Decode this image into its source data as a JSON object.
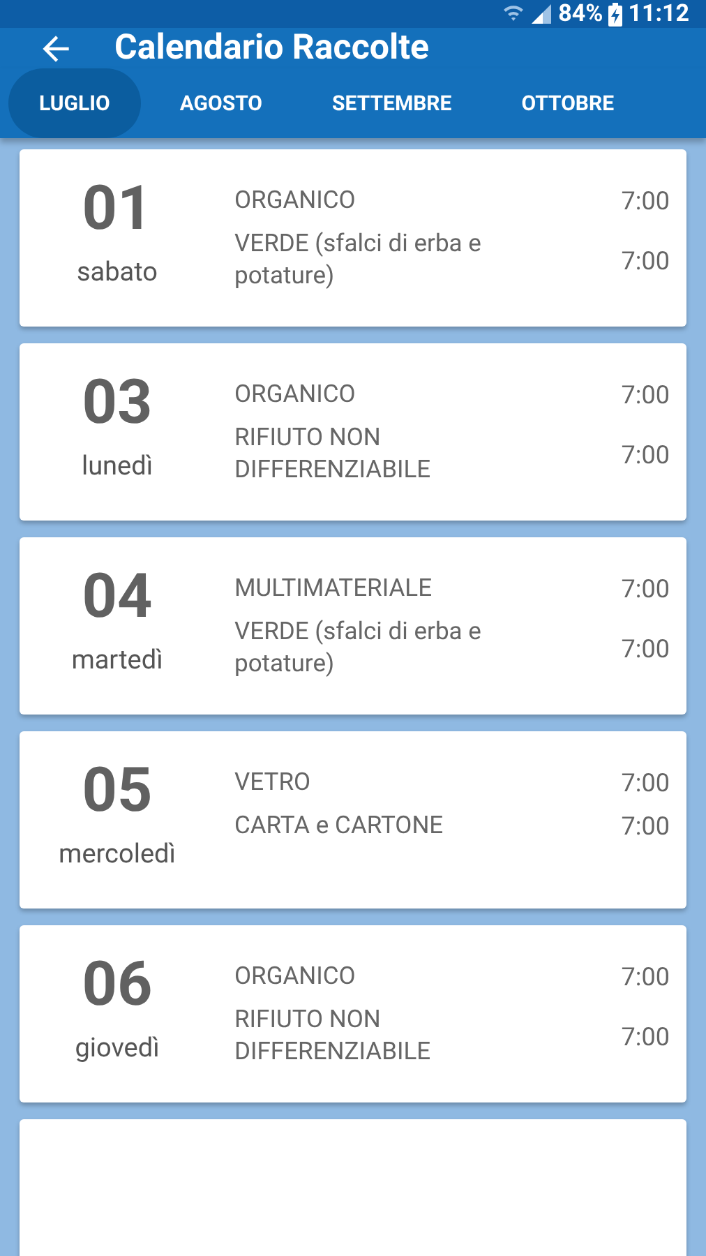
{
  "status_bar": {
    "battery": "84%",
    "time": "11:12"
  },
  "app_bar": {
    "title": "Calendario Raccolte"
  },
  "tabs": [
    {
      "label": "LUGLIO",
      "selected": true
    },
    {
      "label": "AGOSTO",
      "selected": false
    },
    {
      "label": "SETTEMBRE",
      "selected": false
    },
    {
      "label": "OTTOBRE",
      "selected": false
    }
  ],
  "days": [
    {
      "date": "01",
      "weekday": "sabato",
      "collections": [
        {
          "type": "ORGANICO",
          "time": "7:00"
        },
        {
          "type": "VERDE (sfalci di erba e potature)",
          "time": "7:00"
        }
      ]
    },
    {
      "date": "03",
      "weekday": "lunedì",
      "collections": [
        {
          "type": "ORGANICO",
          "time": "7:00"
        },
        {
          "type": "RIFIUTO NON DIFFERENZIABILE",
          "time": "7:00"
        }
      ]
    },
    {
      "date": "04",
      "weekday": "martedì",
      "collections": [
        {
          "type": "MULTIMATERIALE",
          "time": "7:00"
        },
        {
          "type": "VERDE (sfalci di erba e potature)",
          "time": "7:00"
        }
      ]
    },
    {
      "date": "05",
      "weekday": "mercoledì",
      "collections": [
        {
          "type": "VETRO",
          "time": "7:00"
        },
        {
          "type": "CARTA e CARTONE",
          "time": "7:00"
        }
      ]
    },
    {
      "date": "06",
      "weekday": "giovedì",
      "collections": [
        {
          "type": "ORGANICO",
          "time": "7:00"
        },
        {
          "type": "RIFIUTO NON DIFFERENZIABILE",
          "time": "7:00"
        }
      ]
    }
  ]
}
